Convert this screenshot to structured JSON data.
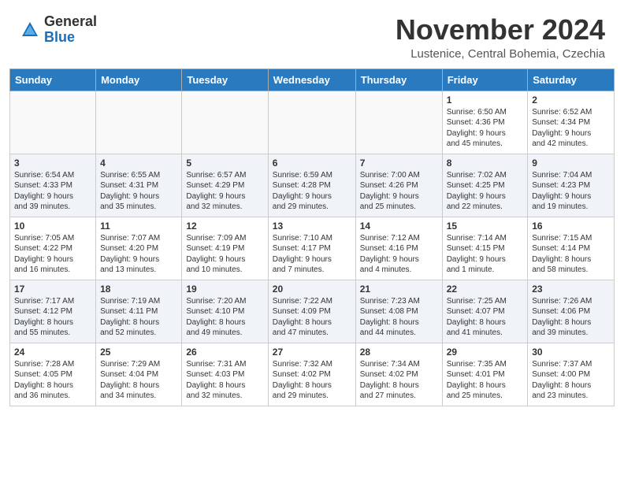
{
  "header": {
    "logo_general": "General",
    "logo_blue": "Blue",
    "month_title": "November 2024",
    "location": "Lustenice, Central Bohemia, Czechia"
  },
  "days_of_week": [
    "Sunday",
    "Monday",
    "Tuesday",
    "Wednesday",
    "Thursday",
    "Friday",
    "Saturday"
  ],
  "weeks": [
    [
      {
        "day": "",
        "info": ""
      },
      {
        "day": "",
        "info": ""
      },
      {
        "day": "",
        "info": ""
      },
      {
        "day": "",
        "info": ""
      },
      {
        "day": "",
        "info": ""
      },
      {
        "day": "1",
        "info": "Sunrise: 6:50 AM\nSunset: 4:36 PM\nDaylight: 9 hours\nand 45 minutes."
      },
      {
        "day": "2",
        "info": "Sunrise: 6:52 AM\nSunset: 4:34 PM\nDaylight: 9 hours\nand 42 minutes."
      }
    ],
    [
      {
        "day": "3",
        "info": "Sunrise: 6:54 AM\nSunset: 4:33 PM\nDaylight: 9 hours\nand 39 minutes."
      },
      {
        "day": "4",
        "info": "Sunrise: 6:55 AM\nSunset: 4:31 PM\nDaylight: 9 hours\nand 35 minutes."
      },
      {
        "day": "5",
        "info": "Sunrise: 6:57 AM\nSunset: 4:29 PM\nDaylight: 9 hours\nand 32 minutes."
      },
      {
        "day": "6",
        "info": "Sunrise: 6:59 AM\nSunset: 4:28 PM\nDaylight: 9 hours\nand 29 minutes."
      },
      {
        "day": "7",
        "info": "Sunrise: 7:00 AM\nSunset: 4:26 PM\nDaylight: 9 hours\nand 25 minutes."
      },
      {
        "day": "8",
        "info": "Sunrise: 7:02 AM\nSunset: 4:25 PM\nDaylight: 9 hours\nand 22 minutes."
      },
      {
        "day": "9",
        "info": "Sunrise: 7:04 AM\nSunset: 4:23 PM\nDaylight: 9 hours\nand 19 minutes."
      }
    ],
    [
      {
        "day": "10",
        "info": "Sunrise: 7:05 AM\nSunset: 4:22 PM\nDaylight: 9 hours\nand 16 minutes."
      },
      {
        "day": "11",
        "info": "Sunrise: 7:07 AM\nSunset: 4:20 PM\nDaylight: 9 hours\nand 13 minutes."
      },
      {
        "day": "12",
        "info": "Sunrise: 7:09 AM\nSunset: 4:19 PM\nDaylight: 9 hours\nand 10 minutes."
      },
      {
        "day": "13",
        "info": "Sunrise: 7:10 AM\nSunset: 4:17 PM\nDaylight: 9 hours\nand 7 minutes."
      },
      {
        "day": "14",
        "info": "Sunrise: 7:12 AM\nSunset: 4:16 PM\nDaylight: 9 hours\nand 4 minutes."
      },
      {
        "day": "15",
        "info": "Sunrise: 7:14 AM\nSunset: 4:15 PM\nDaylight: 9 hours\nand 1 minute."
      },
      {
        "day": "16",
        "info": "Sunrise: 7:15 AM\nSunset: 4:14 PM\nDaylight: 8 hours\nand 58 minutes."
      }
    ],
    [
      {
        "day": "17",
        "info": "Sunrise: 7:17 AM\nSunset: 4:12 PM\nDaylight: 8 hours\nand 55 minutes."
      },
      {
        "day": "18",
        "info": "Sunrise: 7:19 AM\nSunset: 4:11 PM\nDaylight: 8 hours\nand 52 minutes."
      },
      {
        "day": "19",
        "info": "Sunrise: 7:20 AM\nSunset: 4:10 PM\nDaylight: 8 hours\nand 49 minutes."
      },
      {
        "day": "20",
        "info": "Sunrise: 7:22 AM\nSunset: 4:09 PM\nDaylight: 8 hours\nand 47 minutes."
      },
      {
        "day": "21",
        "info": "Sunrise: 7:23 AM\nSunset: 4:08 PM\nDaylight: 8 hours\nand 44 minutes."
      },
      {
        "day": "22",
        "info": "Sunrise: 7:25 AM\nSunset: 4:07 PM\nDaylight: 8 hours\nand 41 minutes."
      },
      {
        "day": "23",
        "info": "Sunrise: 7:26 AM\nSunset: 4:06 PM\nDaylight: 8 hours\nand 39 minutes."
      }
    ],
    [
      {
        "day": "24",
        "info": "Sunrise: 7:28 AM\nSunset: 4:05 PM\nDaylight: 8 hours\nand 36 minutes."
      },
      {
        "day": "25",
        "info": "Sunrise: 7:29 AM\nSunset: 4:04 PM\nDaylight: 8 hours\nand 34 minutes."
      },
      {
        "day": "26",
        "info": "Sunrise: 7:31 AM\nSunset: 4:03 PM\nDaylight: 8 hours\nand 32 minutes."
      },
      {
        "day": "27",
        "info": "Sunrise: 7:32 AM\nSunset: 4:02 PM\nDaylight: 8 hours\nand 29 minutes."
      },
      {
        "day": "28",
        "info": "Sunrise: 7:34 AM\nSunset: 4:02 PM\nDaylight: 8 hours\nand 27 minutes."
      },
      {
        "day": "29",
        "info": "Sunrise: 7:35 AM\nSunset: 4:01 PM\nDaylight: 8 hours\nand 25 minutes."
      },
      {
        "day": "30",
        "info": "Sunrise: 7:37 AM\nSunset: 4:00 PM\nDaylight: 8 hours\nand 23 minutes."
      }
    ]
  ]
}
